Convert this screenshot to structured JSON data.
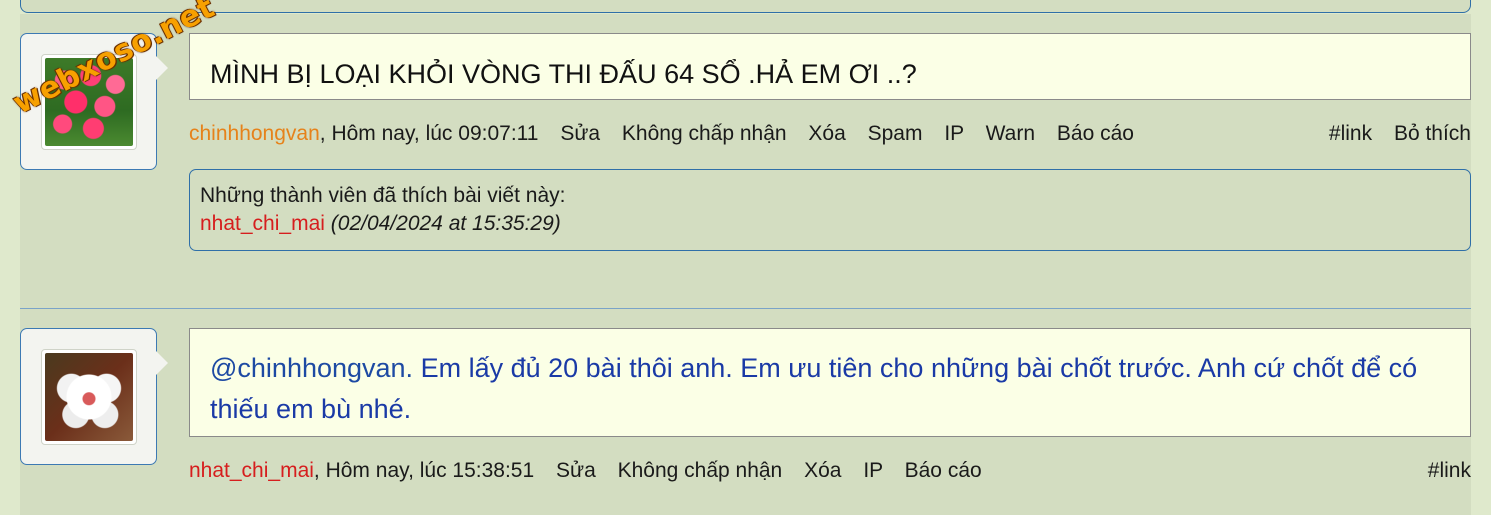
{
  "watermark": "webxoso.net",
  "posts": [
    {
      "title": "MÌNH BỊ LOẠI KHỎI VÒNG THI ĐẤU 64 SỔ .HẢ EM ƠI ..?",
      "author": "chinhhongvan",
      "time": ", Hôm nay, lúc 09:07:11",
      "actions": [
        "Sửa",
        "Không chấp nhận",
        "Xóa",
        "Spam",
        "IP",
        "Warn",
        "Báo cáo"
      ],
      "right_actions": [
        "#link",
        "Bỏ thích"
      ],
      "likes": {
        "heading": "Những thành viên đã thích bài viết này:",
        "user": "nhat_chi_mai",
        "at": "(02/04/2024 at 15:35:29)"
      }
    },
    {
      "mention": "@chinhhongvan.",
      "body": "Em lấy đủ 20 bài thôi anh. Em ưu tiên cho những bài chốt trước. Anh cứ chốt để có thiếu em bù nhé.",
      "author": "nhat_chi_mai",
      "time": ", Hôm nay, lúc 15:38:51",
      "actions": [
        "Sửa",
        "Không chấp nhận",
        "Xóa",
        "IP",
        "Báo cáo"
      ],
      "right_actions": [
        "#link"
      ]
    }
  ]
}
